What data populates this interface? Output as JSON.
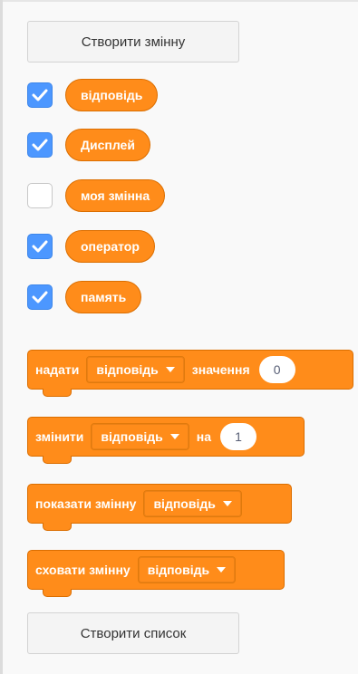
{
  "buttons": {
    "create_variable": "Створити змінну",
    "create_list": "Створити список"
  },
  "variables": [
    {
      "label": "відповідь",
      "checked": true
    },
    {
      "label": "Дисплей",
      "checked": true
    },
    {
      "label": "моя змінна",
      "checked": false
    },
    {
      "label": "оператор",
      "checked": true
    },
    {
      "label": "память",
      "checked": true
    }
  ],
  "blocks": {
    "set": {
      "verb": "надати",
      "dropdown": "відповідь",
      "suffix": "значення",
      "value": "0"
    },
    "change": {
      "verb": "змінити",
      "dropdown": "відповідь",
      "suffix": "на",
      "value": "1"
    },
    "show": {
      "verb": "показати змінну",
      "dropdown": "відповідь"
    },
    "hide": {
      "verb": "сховати змінну",
      "dropdown": "відповідь"
    }
  },
  "colors": {
    "block_orange": "#ff8c1a",
    "block_border": "#db6e00",
    "checkbox_blue": "#4c97ff"
  },
  "icons": {
    "checkmark": "checkmark-icon",
    "dropdown_caret": "caret-down-icon"
  }
}
